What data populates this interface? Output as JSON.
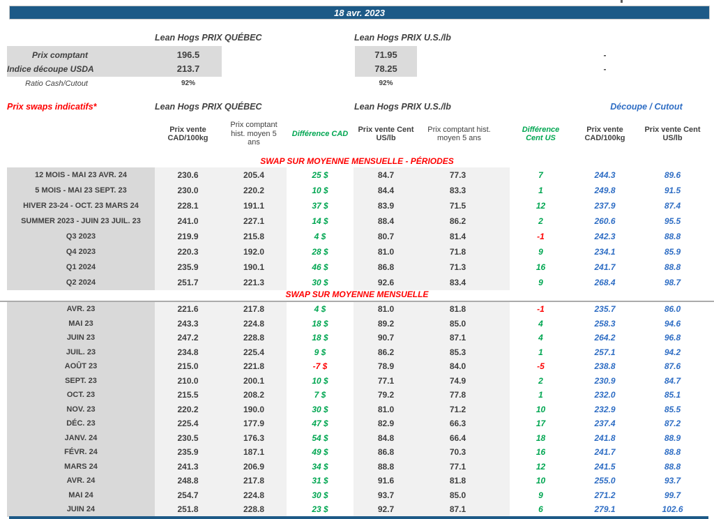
{
  "banner": {
    "date": "18 avr. 2023"
  },
  "colors": {
    "banner_blue": "#1D5A87",
    "accent_green": "#00A651",
    "accent_red": "#FE0000",
    "accent_blue": "#2E6DC4",
    "label_gray": "#D9D9D9",
    "data_gray": "#F1F1F1"
  },
  "spot": {
    "quebec_header": "Lean Hogs PRIX QUÉBEC",
    "us_header": "Lean Hogs PRIX U.S./lb",
    "rows": [
      {
        "label": "Prix comptant",
        "quebec": "196.5",
        "us": "71.95",
        "cutout": "-"
      },
      {
        "label": "Indice découpe USDA",
        "quebec": "213.7",
        "us": "78.25",
        "cutout": "-"
      },
      {
        "label": "Ratio Cash/Cutout",
        "quebec": "92%",
        "us": "92%",
        "cutout": ""
      }
    ]
  },
  "swaps": {
    "title": "Prix swaps indicatifs*",
    "quebec_header": "Lean Hogs PRIX QUÉBEC",
    "us_header": "Lean Hogs PRIX U.S./lb",
    "cutout_header": "Découpe / Cutout",
    "columns": [
      "",
      "Prix vente CAD/100kg",
      "Prix comptant hist. moyen 5 ans",
      "Différence CAD",
      "Prix vente Cent US/lb",
      "Prix comptant hist. moyen 5 ans",
      "Différence Cent US",
      "Prix vente CAD/100kg",
      "Prix vente Cent US/lb"
    ],
    "sections": [
      {
        "title": "SWAP SUR MOYENNE MENSUELLE - PÉRIODES",
        "rows": [
          {
            "label": "12 MOIS - MAI 23 AVR. 24",
            "qc_vente": "230.6",
            "qc_hist": "205.4",
            "diff_cad": "25 $",
            "us_vente": "84.7",
            "us_hist": "77.3",
            "diff_us": "7",
            "dec_cad": "244.3",
            "dec_us": "89.6"
          },
          {
            "label": "5 MOIS - MAI 23 SEPT. 23",
            "qc_vente": "230.0",
            "qc_hist": "220.2",
            "diff_cad": "10 $",
            "us_vente": "84.4",
            "us_hist": "83.3",
            "diff_us": "1",
            "dec_cad": "249.8",
            "dec_us": "91.5"
          },
          {
            "label": "HIVER 23-24 - OCT. 23 MARS 24",
            "qc_vente": "228.1",
            "qc_hist": "191.1",
            "diff_cad": "37 $",
            "us_vente": "83.9",
            "us_hist": "71.5",
            "diff_us": "12",
            "dec_cad": "237.9",
            "dec_us": "87.4"
          },
          {
            "label": "SUMMER 2023 - JUIN 23 JUIL. 23",
            "qc_vente": "241.0",
            "qc_hist": "227.1",
            "diff_cad": "14 $",
            "us_vente": "88.4",
            "us_hist": "86.2",
            "diff_us": "2",
            "dec_cad": "260.6",
            "dec_us": "95.5"
          },
          {
            "label": "Q3 2023",
            "qc_vente": "219.9",
            "qc_hist": "215.8",
            "diff_cad": "4 $",
            "us_vente": "80.7",
            "us_hist": "81.4",
            "diff_us": "-1",
            "dec_cad": "242.3",
            "dec_us": "88.8"
          },
          {
            "label": "Q4 2023",
            "qc_vente": "220.3",
            "qc_hist": "192.0",
            "diff_cad": "28 $",
            "us_vente": "81.0",
            "us_hist": "71.8",
            "diff_us": "9",
            "dec_cad": "234.1",
            "dec_us": "85.9"
          },
          {
            "label": "Q1 2024",
            "qc_vente": "235.9",
            "qc_hist": "190.1",
            "diff_cad": "46 $",
            "us_vente": "86.8",
            "us_hist": "71.3",
            "diff_us": "16",
            "dec_cad": "241.7",
            "dec_us": "88.8"
          },
          {
            "label": "Q2 2024",
            "qc_vente": "251.7",
            "qc_hist": "221.3",
            "diff_cad": "30 $",
            "us_vente": "92.6",
            "us_hist": "83.4",
            "diff_us": "9",
            "dec_cad": "268.4",
            "dec_us": "98.7"
          }
        ]
      },
      {
        "title": "SWAP SUR MOYENNE MENSUELLE",
        "rows": [
          {
            "label": "AVR. 23",
            "qc_vente": "221.6",
            "qc_hist": "217.8",
            "diff_cad": "4 $",
            "us_vente": "81.0",
            "us_hist": "81.8",
            "diff_us": "-1",
            "dec_cad": "235.7",
            "dec_us": "86.0"
          },
          {
            "label": "MAI 23",
            "qc_vente": "243.3",
            "qc_hist": "224.8",
            "diff_cad": "18 $",
            "us_vente": "89.2",
            "us_hist": "85.0",
            "diff_us": "4",
            "dec_cad": "258.3",
            "dec_us": "94.6"
          },
          {
            "label": "JUIN 23",
            "qc_vente": "247.2",
            "qc_hist": "228.8",
            "diff_cad": "18 $",
            "us_vente": "90.7",
            "us_hist": "87.1",
            "diff_us": "4",
            "dec_cad": "264.2",
            "dec_us": "96.8"
          },
          {
            "label": "JUIL. 23",
            "qc_vente": "234.8",
            "qc_hist": "225.4",
            "diff_cad": "9 $",
            "us_vente": "86.2",
            "us_hist": "85.3",
            "diff_us": "1",
            "dec_cad": "257.1",
            "dec_us": "94.2"
          },
          {
            "label": "AOÛT 23",
            "qc_vente": "215.0",
            "qc_hist": "221.8",
            "diff_cad": "-7 $",
            "us_vente": "78.9",
            "us_hist": "84.0",
            "diff_us": "-5",
            "dec_cad": "238.8",
            "dec_us": "87.6"
          },
          {
            "label": "SEPT. 23",
            "qc_vente": "210.0",
            "qc_hist": "200.1",
            "diff_cad": "10 $",
            "us_vente": "77.1",
            "us_hist": "74.9",
            "diff_us": "2",
            "dec_cad": "230.9",
            "dec_us": "84.7"
          },
          {
            "label": "OCT. 23",
            "qc_vente": "215.5",
            "qc_hist": "208.2",
            "diff_cad": "7 $",
            "us_vente": "79.2",
            "us_hist": "77.8",
            "diff_us": "1",
            "dec_cad": "232.0",
            "dec_us": "85.1"
          },
          {
            "label": "NOV. 23",
            "qc_vente": "220.2",
            "qc_hist": "190.0",
            "diff_cad": "30 $",
            "us_vente": "81.0",
            "us_hist": "71.2",
            "diff_us": "10",
            "dec_cad": "232.9",
            "dec_us": "85.5"
          },
          {
            "label": "DÉC. 23",
            "qc_vente": "225.4",
            "qc_hist": "177.9",
            "diff_cad": "47 $",
            "us_vente": "82.9",
            "us_hist": "66.3",
            "diff_us": "17",
            "dec_cad": "237.4",
            "dec_us": "87.2"
          },
          {
            "label": "JANV. 24",
            "qc_vente": "230.5",
            "qc_hist": "176.3",
            "diff_cad": "54 $",
            "us_vente": "84.8",
            "us_hist": "66.4",
            "diff_us": "18",
            "dec_cad": "241.8",
            "dec_us": "88.9"
          },
          {
            "label": "FÉVR. 24",
            "qc_vente": "235.9",
            "qc_hist": "187.1",
            "diff_cad": "49 $",
            "us_vente": "86.8",
            "us_hist": "70.3",
            "diff_us": "16",
            "dec_cad": "241.7",
            "dec_us": "88.8"
          },
          {
            "label": "MARS 24",
            "qc_vente": "241.3",
            "qc_hist": "206.9",
            "diff_cad": "34 $",
            "us_vente": "88.8",
            "us_hist": "77.1",
            "diff_us": "12",
            "dec_cad": "241.5",
            "dec_us": "88.8"
          },
          {
            "label": "AVR. 24",
            "qc_vente": "248.8",
            "qc_hist": "217.8",
            "diff_cad": "31 $",
            "us_vente": "91.6",
            "us_hist": "81.8",
            "diff_us": "10",
            "dec_cad": "255.0",
            "dec_us": "93.7"
          },
          {
            "label": "MAI 24",
            "qc_vente": "254.7",
            "qc_hist": "224.8",
            "diff_cad": "30 $",
            "us_vente": "93.7",
            "us_hist": "85.0",
            "diff_us": "9",
            "dec_cad": "271.2",
            "dec_us": "99.7"
          },
          {
            "label": "JUIN 24",
            "qc_vente": "251.8",
            "qc_hist": "228.8",
            "diff_cad": "23 $",
            "us_vente": "92.7",
            "us_hist": "87.1",
            "diff_us": "6",
            "dec_cad": "279.1",
            "dec_us": "102.6"
          }
        ]
      }
    ]
  }
}
